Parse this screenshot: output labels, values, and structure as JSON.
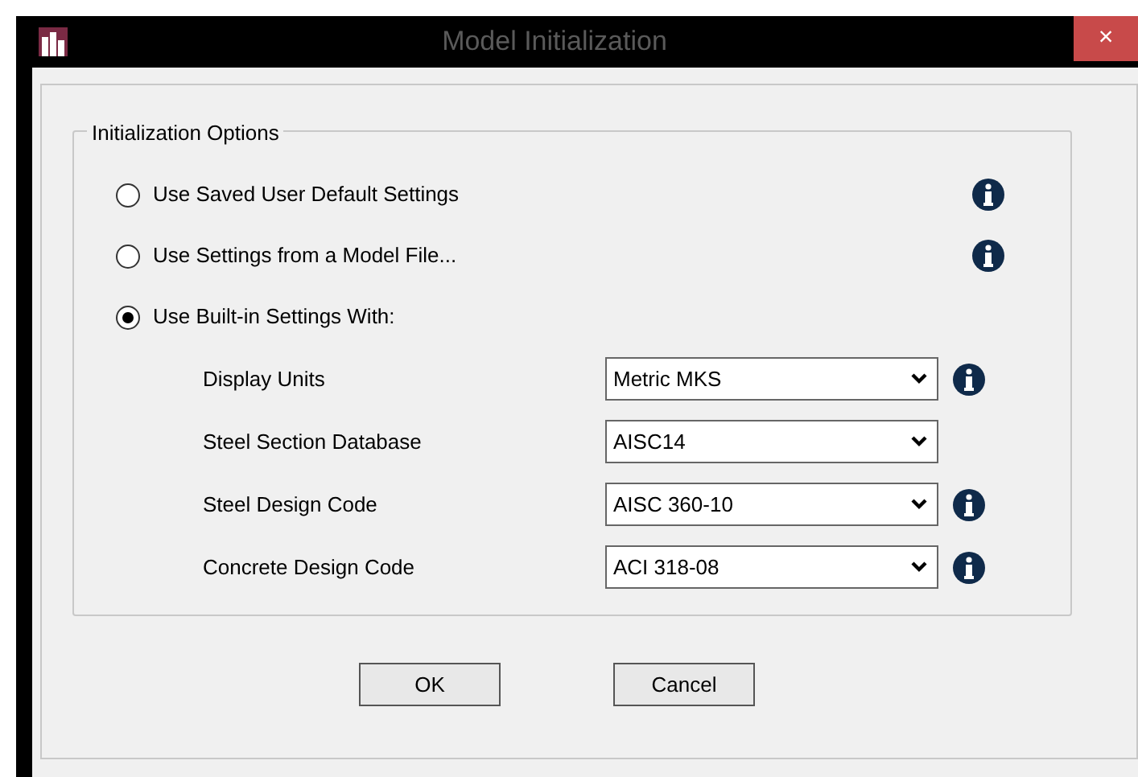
{
  "window": {
    "title": "Model Initialization",
    "close": "×"
  },
  "group": {
    "title": "Initialization Options",
    "options": [
      {
        "label": "Use Saved User Default Settings",
        "selected": false,
        "info": true
      },
      {
        "label": "Use Settings from a Model File...",
        "selected": false,
        "info": true
      },
      {
        "label": "Use Built-in Settings With:",
        "selected": true,
        "info": false
      }
    ],
    "settings": [
      {
        "label": "Display Units",
        "value": "Metric MKS",
        "info": true
      },
      {
        "label": "Steel Section Database",
        "value": "AISC14",
        "info": false
      },
      {
        "label": "Steel Design Code",
        "value": "AISC 360-10",
        "info": true
      },
      {
        "label": "Concrete Design Code",
        "value": "ACI 318-08",
        "info": true
      }
    ]
  },
  "buttons": [
    "OK",
    "Cancel"
  ]
}
